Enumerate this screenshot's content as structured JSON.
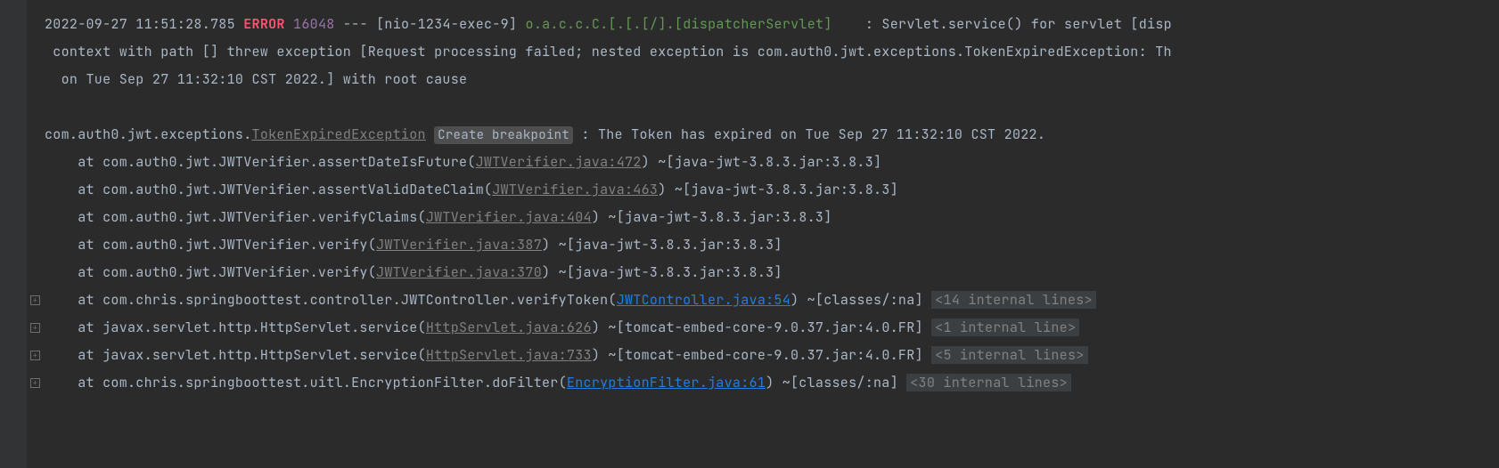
{
  "header": {
    "timestamp": "2022-09-27 11:51:28.785",
    "level": "ERROR",
    "pid": "16048",
    "sep": "---",
    "thread": "[nio-1234-exec-9]",
    "logger": "o.a.c.c.C.[.[.[/].[dispatcherServlet]",
    "msg_start": ": Servlet.service() for servlet [disp"
  },
  "wrap1": " context with path [] threw exception [Request processing failed; nested exception is com.auth0.jwt.exceptions.TokenExpiredException: Th",
  "wrap2": "  on Tue Sep 27 11:32:10 CST 2022.] with root cause",
  "exception": {
    "class_prefix": "com.auth0.jwt.exceptions.",
    "class_link": "TokenExpiredException",
    "create_bp": "Create breakpoint",
    "msg": ": The Token has expired on Tue Sep 27 11:32:10 CST 2022."
  },
  "stack": [
    {
      "prefix": "    at com.auth0.jwt.JWTVerifier.assertDateIsFuture(",
      "link": "JWTVerifier.java:472",
      "link_type": "gray",
      "suffix": ") ~[java-jwt-3.8.3.jar:3.8.3]",
      "expand": false,
      "internal": ""
    },
    {
      "prefix": "    at com.auth0.jwt.JWTVerifier.assertValidDateClaim(",
      "link": "JWTVerifier.java:463",
      "link_type": "gray",
      "suffix": ") ~[java-jwt-3.8.3.jar:3.8.3]",
      "expand": false,
      "internal": ""
    },
    {
      "prefix": "    at com.auth0.jwt.JWTVerifier.verifyClaims(",
      "link": "JWTVerifier.java:404",
      "link_type": "gray",
      "suffix": ") ~[java-jwt-3.8.3.jar:3.8.3]",
      "expand": false,
      "internal": ""
    },
    {
      "prefix": "    at com.auth0.jwt.JWTVerifier.verify(",
      "link": "JWTVerifier.java:387",
      "link_type": "gray",
      "suffix": ") ~[java-jwt-3.8.3.jar:3.8.3]",
      "expand": false,
      "internal": ""
    },
    {
      "prefix": "    at com.auth0.jwt.JWTVerifier.verify(",
      "link": "JWTVerifier.java:370",
      "link_type": "gray",
      "suffix": ") ~[java-jwt-3.8.3.jar:3.8.3]",
      "expand": false,
      "internal": ""
    },
    {
      "prefix": "    at com.chris.springboottest.controller.JWTController.verifyToken(",
      "link": "JWTController.java:54",
      "link_type": "blue",
      "suffix": ") ~[classes/:na] ",
      "expand": true,
      "internal": "<14 internal lines>"
    },
    {
      "prefix": "    at javax.servlet.http.HttpServlet.service(",
      "link": "HttpServlet.java:626",
      "link_type": "gray",
      "suffix": ") ~[tomcat-embed-core-9.0.37.jar:4.0.FR] ",
      "expand": true,
      "internal": "<1 internal line>"
    },
    {
      "prefix": "    at javax.servlet.http.HttpServlet.service(",
      "link": "HttpServlet.java:733",
      "link_type": "gray",
      "suffix": ") ~[tomcat-embed-core-9.0.37.jar:4.0.FR] ",
      "expand": true,
      "internal": "<5 internal lines>"
    },
    {
      "prefix": "    at com.chris.springboottest.uitl.EncryptionFilter.doFilter(",
      "link": "EncryptionFilter.java:61",
      "link_type": "blue",
      "suffix": ") ~[classes/:na] ",
      "expand": true,
      "internal": "<30 internal lines>"
    }
  ]
}
